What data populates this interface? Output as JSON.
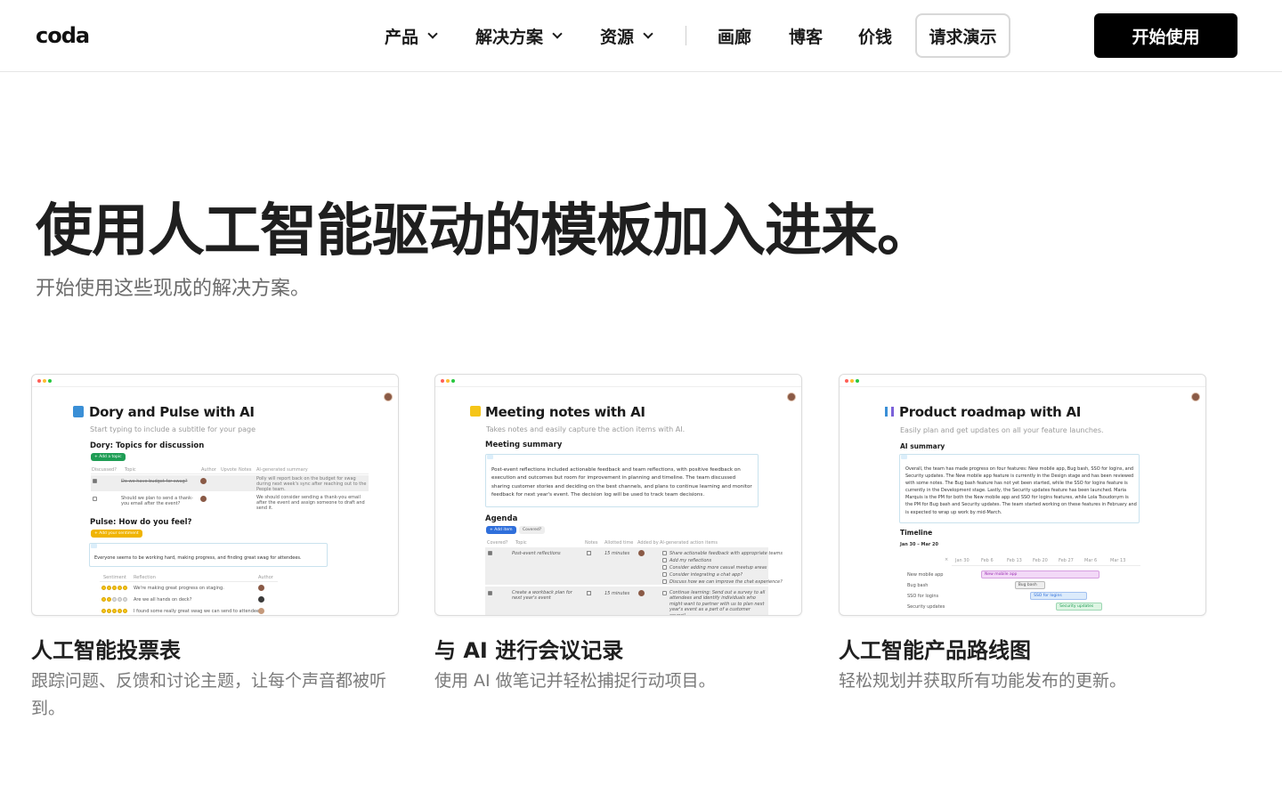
{
  "nav": {
    "logo": "coda",
    "items": [
      {
        "label": "产品",
        "dropdown": true
      },
      {
        "label": "解决方案",
        "dropdown": true
      },
      {
        "label": "资源",
        "dropdown": true
      },
      {
        "label": "画廊",
        "dropdown": false
      },
      {
        "label": "博客",
        "dropdown": false
      },
      {
        "label": "价钱",
        "dropdown": false
      }
    ],
    "demo_label": "请求演示",
    "start_label": "开始使用"
  },
  "hero": {
    "title": "使用人工智能驱动的模板加入进来。",
    "subtitle": "开始使用这些现成的解决方案。"
  },
  "colors": {
    "accent_black": "#000000",
    "dot_red": "#ff5f57",
    "dot_yellow": "#febc2e",
    "dot_green": "#28c840",
    "green_pill": "#1f9d55",
    "yellow_pill": "#f0b400",
    "blue_pill": "#2f6fdb"
  },
  "cards": [
    {
      "title": "人工智能投票表",
      "description": "跟踪问题、反馈和讨论主题，让每个声音都被听到。",
      "thumb": {
        "doc_title": "Dory and Pulse with AI",
        "doc_subtitle": "Start typing to include a subtitle for your page",
        "section1": "Dory: Topics for discussion",
        "add_topic": "+ Add a topic",
        "cols": [
          "Discussed?",
          "Topic",
          "Author",
          "Upvote",
          "Notes",
          "AI-generated summary"
        ],
        "rows": [
          {
            "topic": "Do we have budget for swag?",
            "summary": "Polly will report back on the budget for swag during next week's sync after reaching out to the People team."
          },
          {
            "topic": "Should we plan to send a thank-you email after the event?",
            "summary": "We should consider sending a thank-you email after the event and assign someone to draft and send it."
          }
        ],
        "section2": "Pulse: How do you feel?",
        "add_sentiment": "+ Add your sentiment",
        "ai_summary": "Everyone seems to be working hard, making progress, and finding great swag for attendees.",
        "pulse_cols": [
          "Sentiment",
          "Reflection",
          "Author"
        ],
        "pulse_rows": [
          "We're making great progress on staging.",
          "Are we all hands on deck?",
          "I found some really great swag we can send to attendees."
        ]
      }
    },
    {
      "title": "与 AI 进行会议记录",
      "description": "使用 AI 做笔记并轻松捕捉行动项目。",
      "thumb": {
        "doc_title": "Meeting notes with AI",
        "doc_subtitle": "Takes notes and easily capture the action items with AI.",
        "section1": "Meeting summary",
        "summary": "Post-event reflections included actionable feedback and team reflections, with positive feedback on execution and outcomes but room for improvement in planning and timeline. The team discussed sharing customer stories and deciding on the best channels, and plans to continue learning and monitor feedback for next year's event. The decision log will be used to track team decisions.",
        "section2": "Agenda",
        "add_item": "+ Add item",
        "filter": "Covered?",
        "cols": [
          "Covered?",
          "Topic",
          "Notes",
          "Allotted time",
          "Added by",
          "AI-generated action items"
        ],
        "rows": [
          {
            "topic": "Post-event reflections",
            "time": "15 minutes",
            "actions": [
              "Share actionable feedback with appropriate teams",
              "Add my reflections",
              "Consider adding more casual meetup areas",
              "Consider integrating a chat app?",
              "Discuss how we can improve the chat experience?"
            ]
          },
          {
            "topic": "Create a workback plan for next year's event",
            "time": "15 minutes",
            "actions": [
              "Continue learning: Send out a survey to all attendees and identify individuals who might want to partner with us to plan next year's event as a part of a customer council."
            ]
          }
        ]
      }
    },
    {
      "title": "人工智能产品路线图",
      "description": "轻松规划并获取所有功能发布的更新。",
      "thumb": {
        "doc_title": "Product roadmap with AI",
        "doc_subtitle": "Easily plan and get updates on all your feature launches.",
        "section1": "AI summary",
        "summary": "Overall, the team has made progress on four features: New mobile app, Bug bash, SSO for logins, and Security updates. The New mobile app feature is currently in the Design stage and has been reviewed with some notes. The Bug bash feature has not yet been started, while the SSO for logins feature is currently in the Development stage. Lastly, the Security updates feature has been launched. Maria Marquis is the PM for both the New mobile app and SSO for logins features, while Lola Tsoudonym is the PM for Bug bash and Security updates. The team started working on these features in February and is expected to wrap up work by mid-March.",
        "section2": "Timeline",
        "range": "Jan 30 – Mar 20",
        "dates": [
          "Jan 30",
          "Feb 6",
          "Feb 13",
          "Feb 20",
          "Feb 27",
          "Mar 6",
          "Mar 13"
        ],
        "features": [
          {
            "name": "New mobile app",
            "start": 1,
            "end": 5.6,
            "color": "#f3d9f7",
            "text": "#9b2db3"
          },
          {
            "name": "Bug bash",
            "start": 2.3,
            "end": 3.5,
            "color": "#eeeeee",
            "text": "#555555"
          },
          {
            "name": "SSO for logins",
            "start": 2.9,
            "end": 5.1,
            "color": "#dcebfb",
            "text": "#2f6fdb"
          },
          {
            "name": "Security updates",
            "start": 3.9,
            "end": 5.7,
            "color": "#ddf5e3",
            "text": "#1f9d55"
          }
        ]
      }
    }
  ]
}
